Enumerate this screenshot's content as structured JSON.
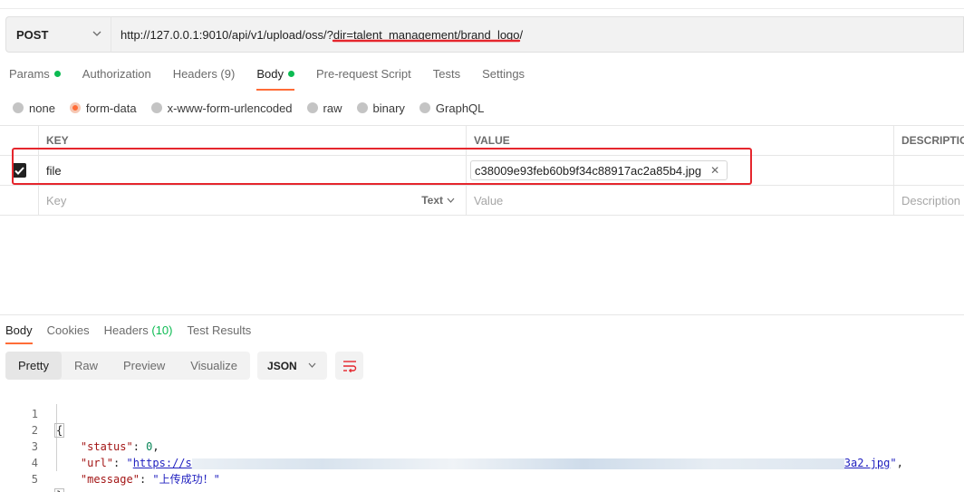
{
  "request": {
    "method": "POST",
    "url": "http://127.0.0.1:9010/api/v1/upload/oss/?dir=talent_management/brand_logo/"
  },
  "request_tabs": [
    {
      "label": "Params",
      "dot": true
    },
    {
      "label": "Authorization"
    },
    {
      "label": "Headers (9)"
    },
    {
      "label": "Body",
      "dot": true,
      "active": true
    },
    {
      "label": "Pre-request Script"
    },
    {
      "label": "Tests"
    },
    {
      "label": "Settings"
    }
  ],
  "body_types": [
    "none",
    "form-data",
    "x-www-form-urlencoded",
    "raw",
    "binary",
    "GraphQL"
  ],
  "body_type_selected": "form-data",
  "table": {
    "headers": [
      "KEY",
      "VALUE",
      "DESCRIPTIO"
    ],
    "row": {
      "key": "file",
      "value": "c38009e93feb60b9f34c88917ac2a85b4.jpg",
      "checked": true
    },
    "new_row": {
      "key_placeholder": "Key",
      "type": "Text",
      "value_placeholder": "Value",
      "desc_placeholder": "Description"
    }
  },
  "response_tabs": [
    {
      "label": "Body",
      "active": true
    },
    {
      "label": "Cookies"
    },
    {
      "label": "Headers",
      "count": "(10)"
    },
    {
      "label": "Test Results"
    }
  ],
  "view_modes": [
    "Pretty",
    "Raw",
    "Preview",
    "Visualize"
  ],
  "view_mode_selected": "Pretty",
  "format": "JSON",
  "response_json": {
    "line_numbers": [
      "1",
      "2",
      "3",
      "4",
      "5"
    ],
    "open_brace": "{",
    "close_brace": "}",
    "status_key": "\"status\"",
    "status_value": "0",
    "url_key": "\"url\"",
    "url_prefix": "https://s",
    "url_suffix": "3a2.jpg",
    "message_key": "\"message\"",
    "message_value": "\"上传成功！\""
  },
  "colors": {
    "accent": "#ff6c37",
    "status_dot": "#0cbb52",
    "highlight": "#e5262d"
  },
  "icons": [
    "chevron-down-icon",
    "close-icon",
    "checkbox-checked-icon",
    "wrap-lines-icon"
  ]
}
